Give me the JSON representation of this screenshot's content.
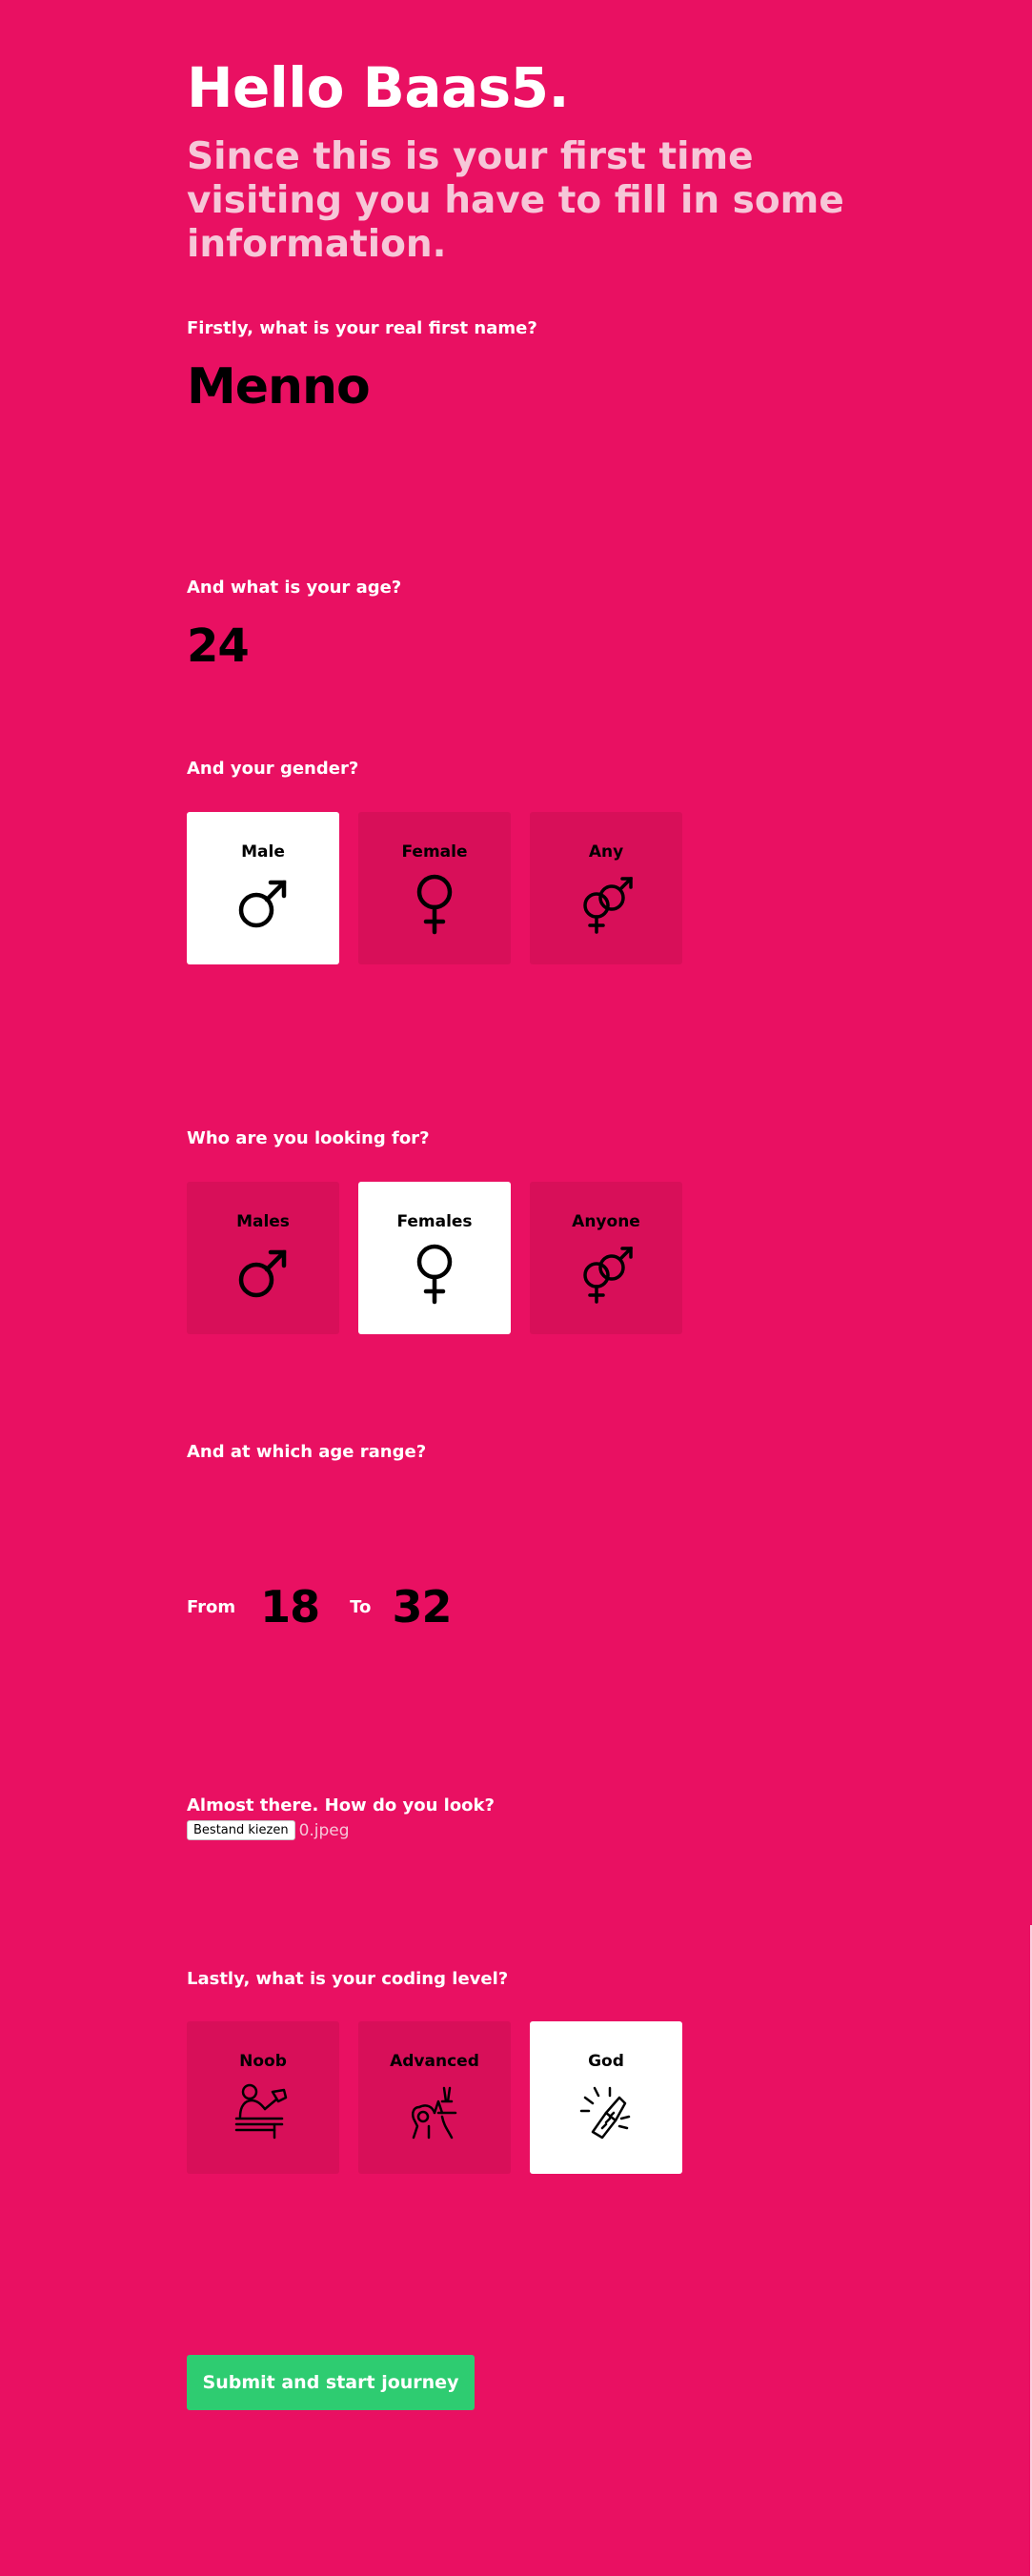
{
  "header": {
    "greeting": "Hello Baas5.",
    "subtitle": "Since this is your first time visiting you have to fill in some information."
  },
  "name_section": {
    "question": "Firstly, what is your real first name?",
    "value": "Menno"
  },
  "age_section": {
    "question": "And what is your age?",
    "value": "24"
  },
  "gender_section": {
    "question": "And your gender?",
    "options": [
      {
        "label": "Male",
        "icon": "male-symbol-icon",
        "selected": true
      },
      {
        "label": "Female",
        "icon": "female-symbol-icon",
        "selected": false
      },
      {
        "label": "Any",
        "icon": "any-gender-symbol-icon",
        "selected": false
      }
    ]
  },
  "looking_for_section": {
    "question": "Who are you looking for?",
    "options": [
      {
        "label": "Males",
        "icon": "male-symbol-icon",
        "selected": false
      },
      {
        "label": "Females",
        "icon": "female-symbol-icon",
        "selected": true
      },
      {
        "label": "Anyone",
        "icon": "any-gender-symbol-icon",
        "selected": false
      }
    ]
  },
  "age_range_section": {
    "question": "And at which age range?",
    "from_label": "From",
    "from_value": "18",
    "to_label": "To",
    "to_value": "32"
  },
  "photo_section": {
    "question": "Almost there. How do you look?",
    "button_label": "Bestand kiezen",
    "file_name": "0.jpeg"
  },
  "coding_section": {
    "question": "Lastly, what is your coding level?",
    "options": [
      {
        "label": "Noob",
        "icon": "noob-coder-icon",
        "selected": false
      },
      {
        "label": "Advanced",
        "icon": "advanced-coder-icon",
        "selected": false
      },
      {
        "label": "God",
        "icon": "god-coder-icon",
        "selected": true
      }
    ]
  },
  "submit": {
    "label": "Submit and start journey"
  },
  "colors": {
    "background": "#e91062",
    "card": "#d80f59",
    "card_selected": "#ffffff",
    "subtitle": "#f6c7d8",
    "submit": "#2ecc71"
  }
}
